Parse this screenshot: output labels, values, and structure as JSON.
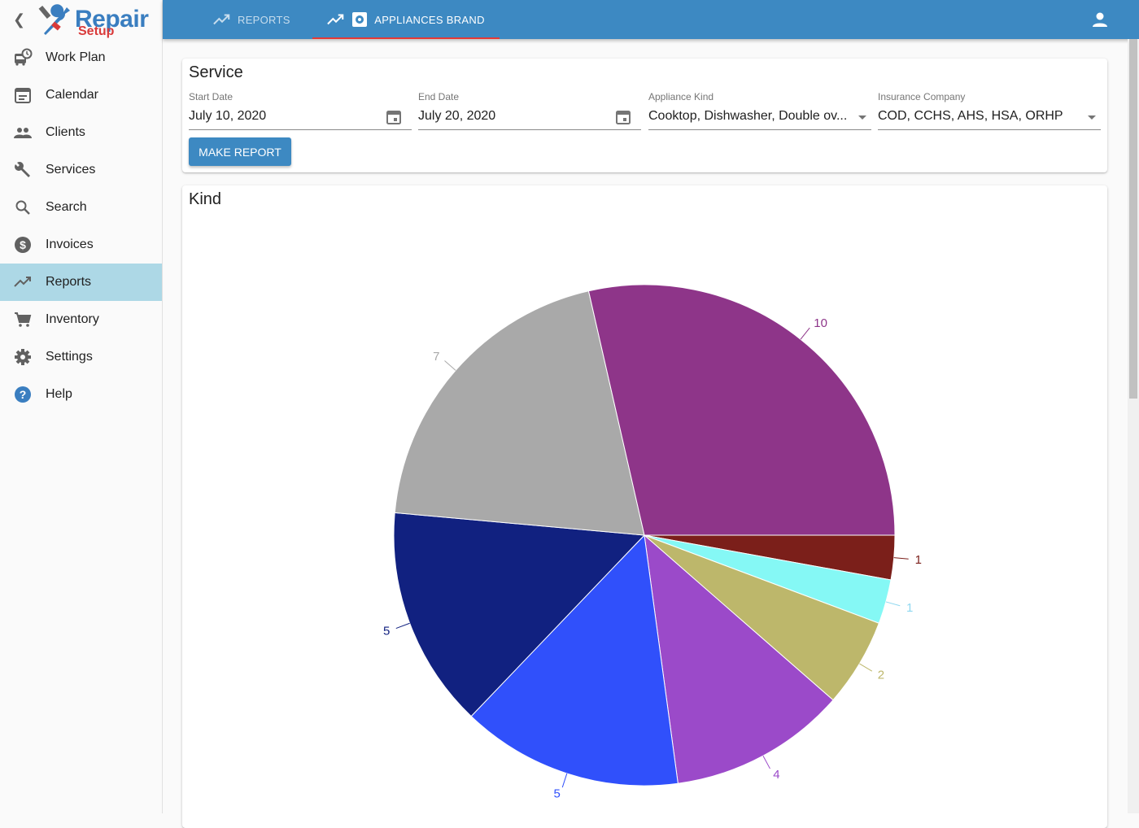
{
  "app": {
    "logo_top": "Repair",
    "logo_bottom": "Setup",
    "back_icon": "chevron-left-icon"
  },
  "sidebar": {
    "items": [
      {
        "label": "Work Plan",
        "icon": "bus-clock-icon",
        "active": false
      },
      {
        "label": "Calendar",
        "icon": "calendar-icon",
        "active": false
      },
      {
        "label": "Clients",
        "icon": "people-icon",
        "active": false
      },
      {
        "label": "Services",
        "icon": "wrench-icon",
        "active": false
      },
      {
        "label": "Search",
        "icon": "search-icon",
        "active": false
      },
      {
        "label": "Invoices",
        "icon": "dollar-icon",
        "active": false
      },
      {
        "label": "Reports",
        "icon": "trending-up-icon",
        "active": true
      },
      {
        "label": "Inventory",
        "icon": "cart-icon",
        "active": false
      },
      {
        "label": "Settings",
        "icon": "gear-icon",
        "active": false
      },
      {
        "label": "Help",
        "icon": "help-icon",
        "active": false
      }
    ]
  },
  "topbar": {
    "tabs": [
      {
        "label": "REPORTS",
        "active": false
      },
      {
        "label": "APPLIANCES BRAND",
        "active": true
      }
    ],
    "user_icon": "account-icon"
  },
  "service": {
    "title": "Service",
    "start_date": {
      "label": "Start Date",
      "value": "July 10, 2020"
    },
    "end_date": {
      "label": "End Date",
      "value": "July 20, 2020"
    },
    "appliance_kind": {
      "label": "Appliance Kind",
      "value": "Cooktop, Dishwasher, Double ov..."
    },
    "insurance_company": {
      "label": "Insurance Company",
      "value": "COD, CCHS, AHS, HSA, ORHP"
    },
    "make_report_label": "MAKE REPORT"
  },
  "colors": {
    "primary": "#3d89c2",
    "active_nav": "#add8e6",
    "tab_indicator": "#e53935"
  },
  "chart_data": {
    "type": "pie",
    "title": "Kind",
    "start_direction": "3 o'clock, clockwise",
    "slices": [
      {
        "value": 1,
        "color": "#7b1f1a"
      },
      {
        "value": 1,
        "color": "#85f8f5"
      },
      {
        "value": 2,
        "color": "#bdb76b"
      },
      {
        "value": 4,
        "color": "#9b4ac9"
      },
      {
        "value": 5,
        "color": "#3050fb"
      },
      {
        "value": 5,
        "color": "#112180"
      },
      {
        "value": 7,
        "color": "#a9a9a9"
      },
      {
        "value": 10,
        "color": "#8e3589"
      }
    ],
    "legend": "none",
    "data_labels": "outside with leader lines"
  }
}
